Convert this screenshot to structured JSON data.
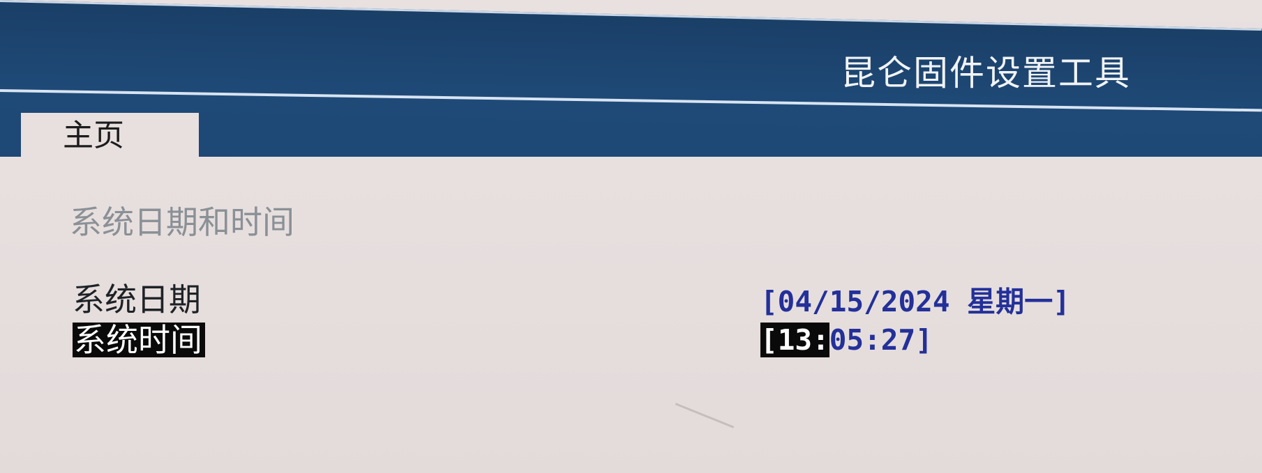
{
  "app": {
    "title": "昆仑固件设置工具"
  },
  "tabs": [
    {
      "label": "主页",
      "active": true
    }
  ],
  "main": {
    "section_title": "系统日期和时间",
    "rows": [
      {
        "label": "系统日期",
        "value_text": "[04/15/2024 星期一]",
        "selected": false
      },
      {
        "label": "系统时间",
        "value_open": "[",
        "value_hour": "13",
        "value_sep1": ":",
        "value_rest": "05:27]",
        "selected": true
      }
    ]
  },
  "colors": {
    "header_bg": "#1f4a78",
    "content_bg": "#e6dedd",
    "value_text": "#23309a",
    "selection_bg": "#0a0a0a",
    "selection_fg": "#ffffff",
    "section_title": "#8a9096"
  }
}
